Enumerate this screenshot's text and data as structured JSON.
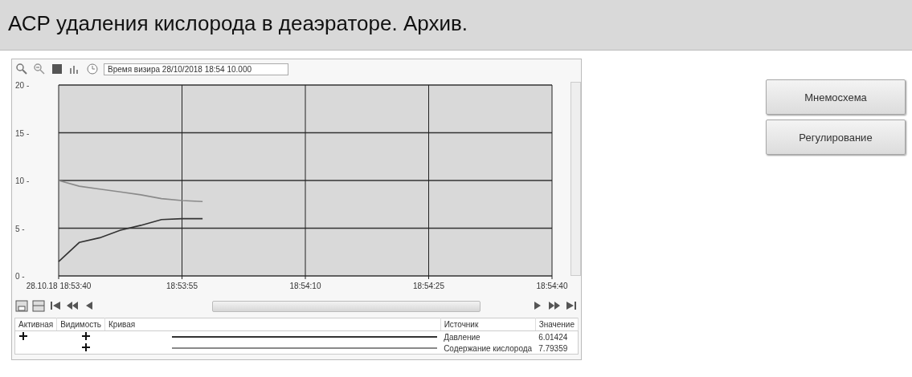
{
  "header": {
    "title": "АСР удаления кислорода в деаэраторе. Архив."
  },
  "toolbar": {
    "cursor_time": "Время визира 28/10/2018 18:54 10.000"
  },
  "chart": {
    "chart_data": {
      "type": "line",
      "categories": [
        "28.10.18 18:53:40",
        null,
        null,
        null,
        null,
        null,
        "18:53:55",
        null,
        null,
        null,
        null,
        null,
        "18:54:10",
        null,
        null,
        null,
        null,
        null,
        "18:54:25",
        null,
        null,
        null,
        null,
        null,
        "18:54:40"
      ],
      "series": [
        {
          "color": "#333333",
          "values": [
            1.5,
            3.5,
            4.0,
            4.8,
            5.3,
            5.9,
            6,
            6,
            null,
            null,
            null,
            null,
            null,
            null,
            null,
            null,
            null,
            null,
            null,
            null,
            null,
            null,
            null,
            null,
            null
          ]
        },
        {
          "color": "#8a8a8a",
          "values": [
            10,
            9.4,
            9.1,
            8.8,
            8.5,
            8.1,
            7.9,
            7.8,
            null,
            null,
            null,
            null,
            null,
            null,
            null,
            null,
            null,
            null,
            null,
            null,
            null,
            null,
            null,
            null,
            null
          ]
        }
      ],
      "ylim": [
        0,
        20
      ],
      "grid": true,
      "yticks": [
        {
          "value": 0,
          "label": "0 -"
        },
        {
          "value": 5,
          "label": "5 -"
        },
        {
          "value": 10,
          "label": "10 -"
        },
        {
          "value": 15,
          "label": "15 -"
        },
        {
          "value": 20,
          "label": "20 -"
        }
      ]
    }
  },
  "legend": {
    "columns": [
      "Активная",
      "Видимость",
      "Кривая",
      "Источник",
      "Значение"
    ],
    "rows": [
      {
        "active": true,
        "visible": true,
        "color": "#333333",
        "source": "Давление",
        "value": "6.01424"
      },
      {
        "active": false,
        "visible": true,
        "color": "#8a8a8a",
        "source": "Содержание кислорода",
        "value": "7.79359"
      }
    ]
  },
  "buttons": [
    "Мнемосхема",
    "Регулирование"
  ]
}
